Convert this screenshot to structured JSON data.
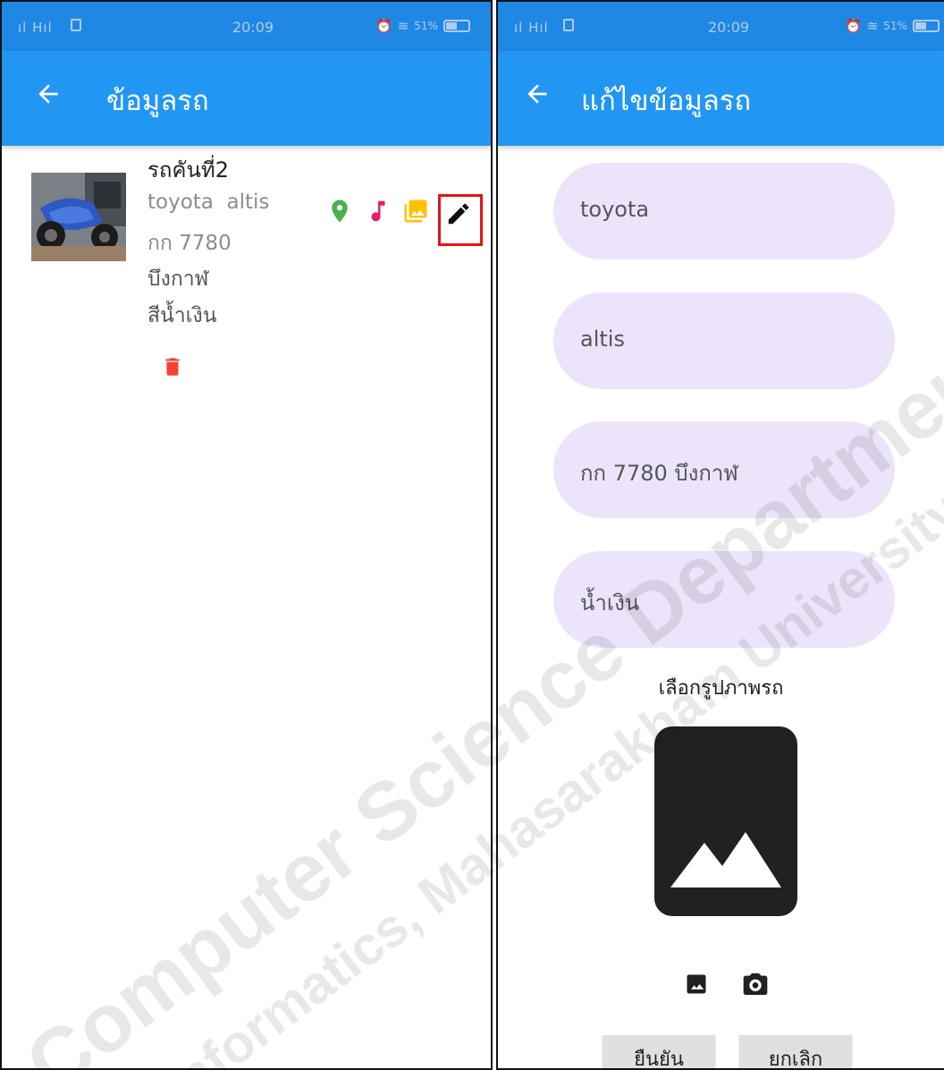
{
  "status_bar": {
    "time": "20:09",
    "signal": "H",
    "battery": "51%"
  },
  "left_screen": {
    "title": "ข้อมูลรถ",
    "car": {
      "name": "รถคันที่2",
      "model": "toyota  altis",
      "plate": "กก 7780",
      "province": "บึงกาฬ",
      "color": "สีน้ำเงิน"
    },
    "icons": [
      "location-pin-icon",
      "music-note-icon",
      "photo-library-icon",
      "edit-pencil-icon",
      "delete-trash-icon"
    ],
    "colors": {
      "location": "#4caf50",
      "music": "#e91e63",
      "photo": "#ffc107",
      "edit": "#111111",
      "delete": "#f44336",
      "highlight": "#e31414"
    }
  },
  "right_screen": {
    "title": "แก้ไขข้อมูลรถ",
    "fields": {
      "brand": "toyota",
      "model": "altis",
      "plate": "กก 7780 บึงกาฬ",
      "color": "น้ำเงิน"
    },
    "pick_image_label": "เลือกรูปภาพรถ",
    "buttons": {
      "confirm": "ยืนยัน",
      "cancel": "ยกเลิก"
    }
  },
  "watermark": {
    "line1": "Computer Science Department",
    "line2": "Informatics, Mahasarakham University"
  },
  "theme": {
    "status_bar": "#1f88e5",
    "app_bar": "#2196f3",
    "field_fill": "#ece4fb"
  }
}
